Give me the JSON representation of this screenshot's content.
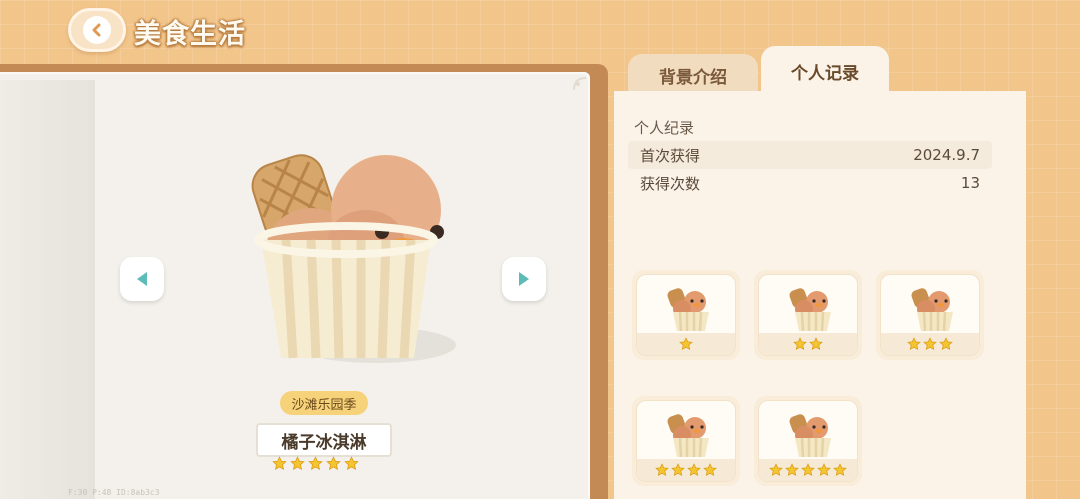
{
  "header": {
    "title": "美食生活"
  },
  "food": {
    "season_badge": "沙滩乐园季",
    "name": "橘子冰淇淋",
    "star_count": 5
  },
  "debug_overlay": "F:30  P:48  ID:8ab3c3",
  "tabs": [
    {
      "label": "背景介绍",
      "active": false
    },
    {
      "label": "个人记录",
      "active": true
    }
  ],
  "record": {
    "heading": "个人纪录",
    "rows": [
      {
        "label": "首次获得",
        "value": "2024.9.7"
      },
      {
        "label": "获得次数",
        "value": "13"
      }
    ]
  },
  "variants": [
    {
      "stars": 1
    },
    {
      "stars": 2
    },
    {
      "stars": 3
    },
    {
      "stars": 4
    },
    {
      "stars": 5
    }
  ],
  "colors": {
    "accent": "#f2c58b",
    "star": "#f5c431",
    "nav_arrow": "#5dbcb8"
  }
}
